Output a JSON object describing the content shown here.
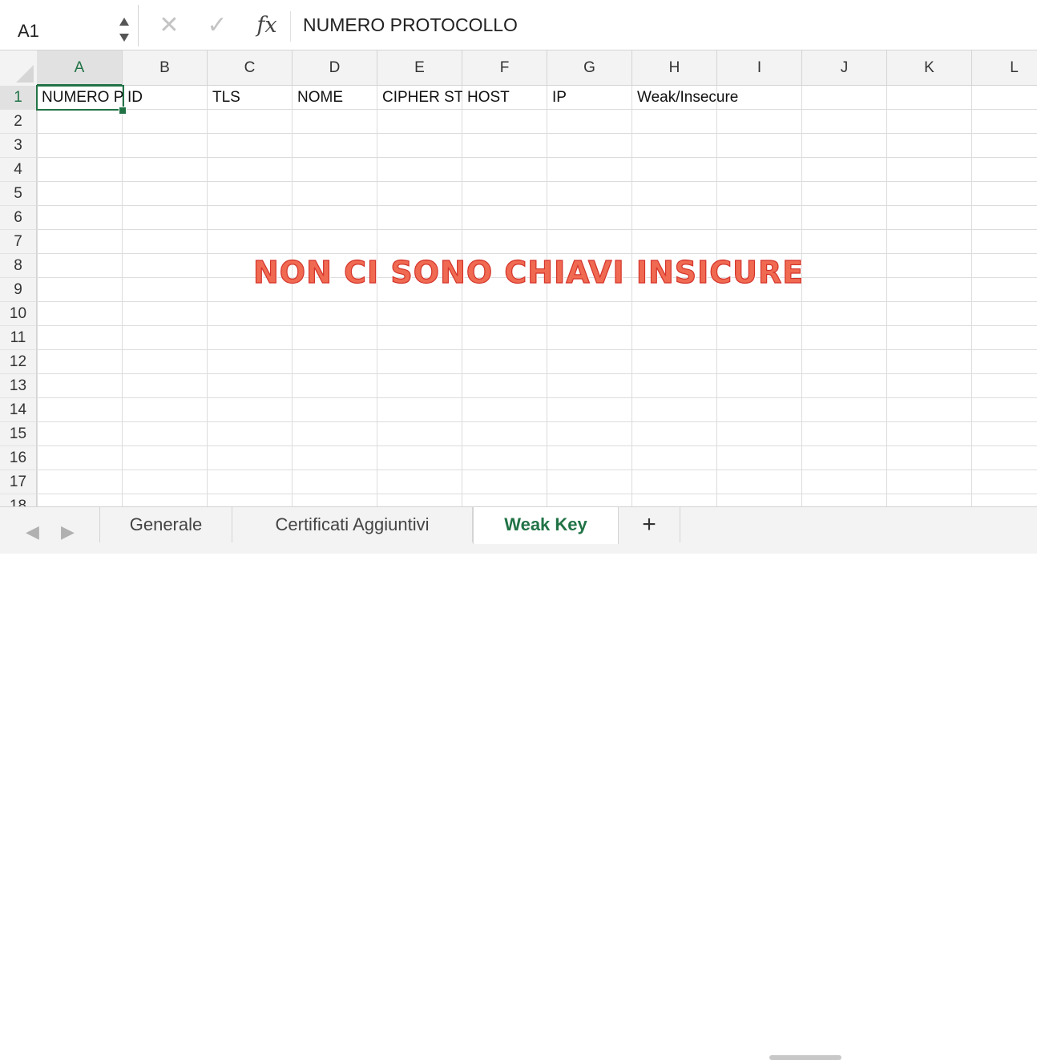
{
  "formula_bar": {
    "cell_reference": "A1",
    "cancel_symbol": "✕",
    "confirm_symbol": "✓",
    "function_symbol": "fx",
    "content": "NUMERO PROTOCOLLO"
  },
  "columns": [
    "A",
    "B",
    "C",
    "D",
    "E",
    "F",
    "G",
    "H",
    "I",
    "J",
    "K",
    "L"
  ],
  "rows": [
    "1",
    "2",
    "3",
    "4",
    "5",
    "6",
    "7",
    "8",
    "9",
    "10",
    "11",
    "12",
    "13",
    "14",
    "15",
    "16",
    "17",
    "18"
  ],
  "row1": {
    "A": "NUMERO PROTOCOLLO",
    "B": "ID",
    "C": "TLS",
    "D": "NOME",
    "E": "CIPHER STRENGTH",
    "F": "HOST",
    "G": "IP",
    "H": "Weak/Insecure"
  },
  "overlay_text": "NON CI SONO CHIAVI INSICURE",
  "tabs": [
    "Generale",
    "Certificati Aggiuntivi",
    "Weak Key"
  ],
  "active_tab": "Weak Key",
  "add_tab_symbol": "+",
  "colors": {
    "accent": "#217346",
    "overlay": "#e8503b"
  }
}
